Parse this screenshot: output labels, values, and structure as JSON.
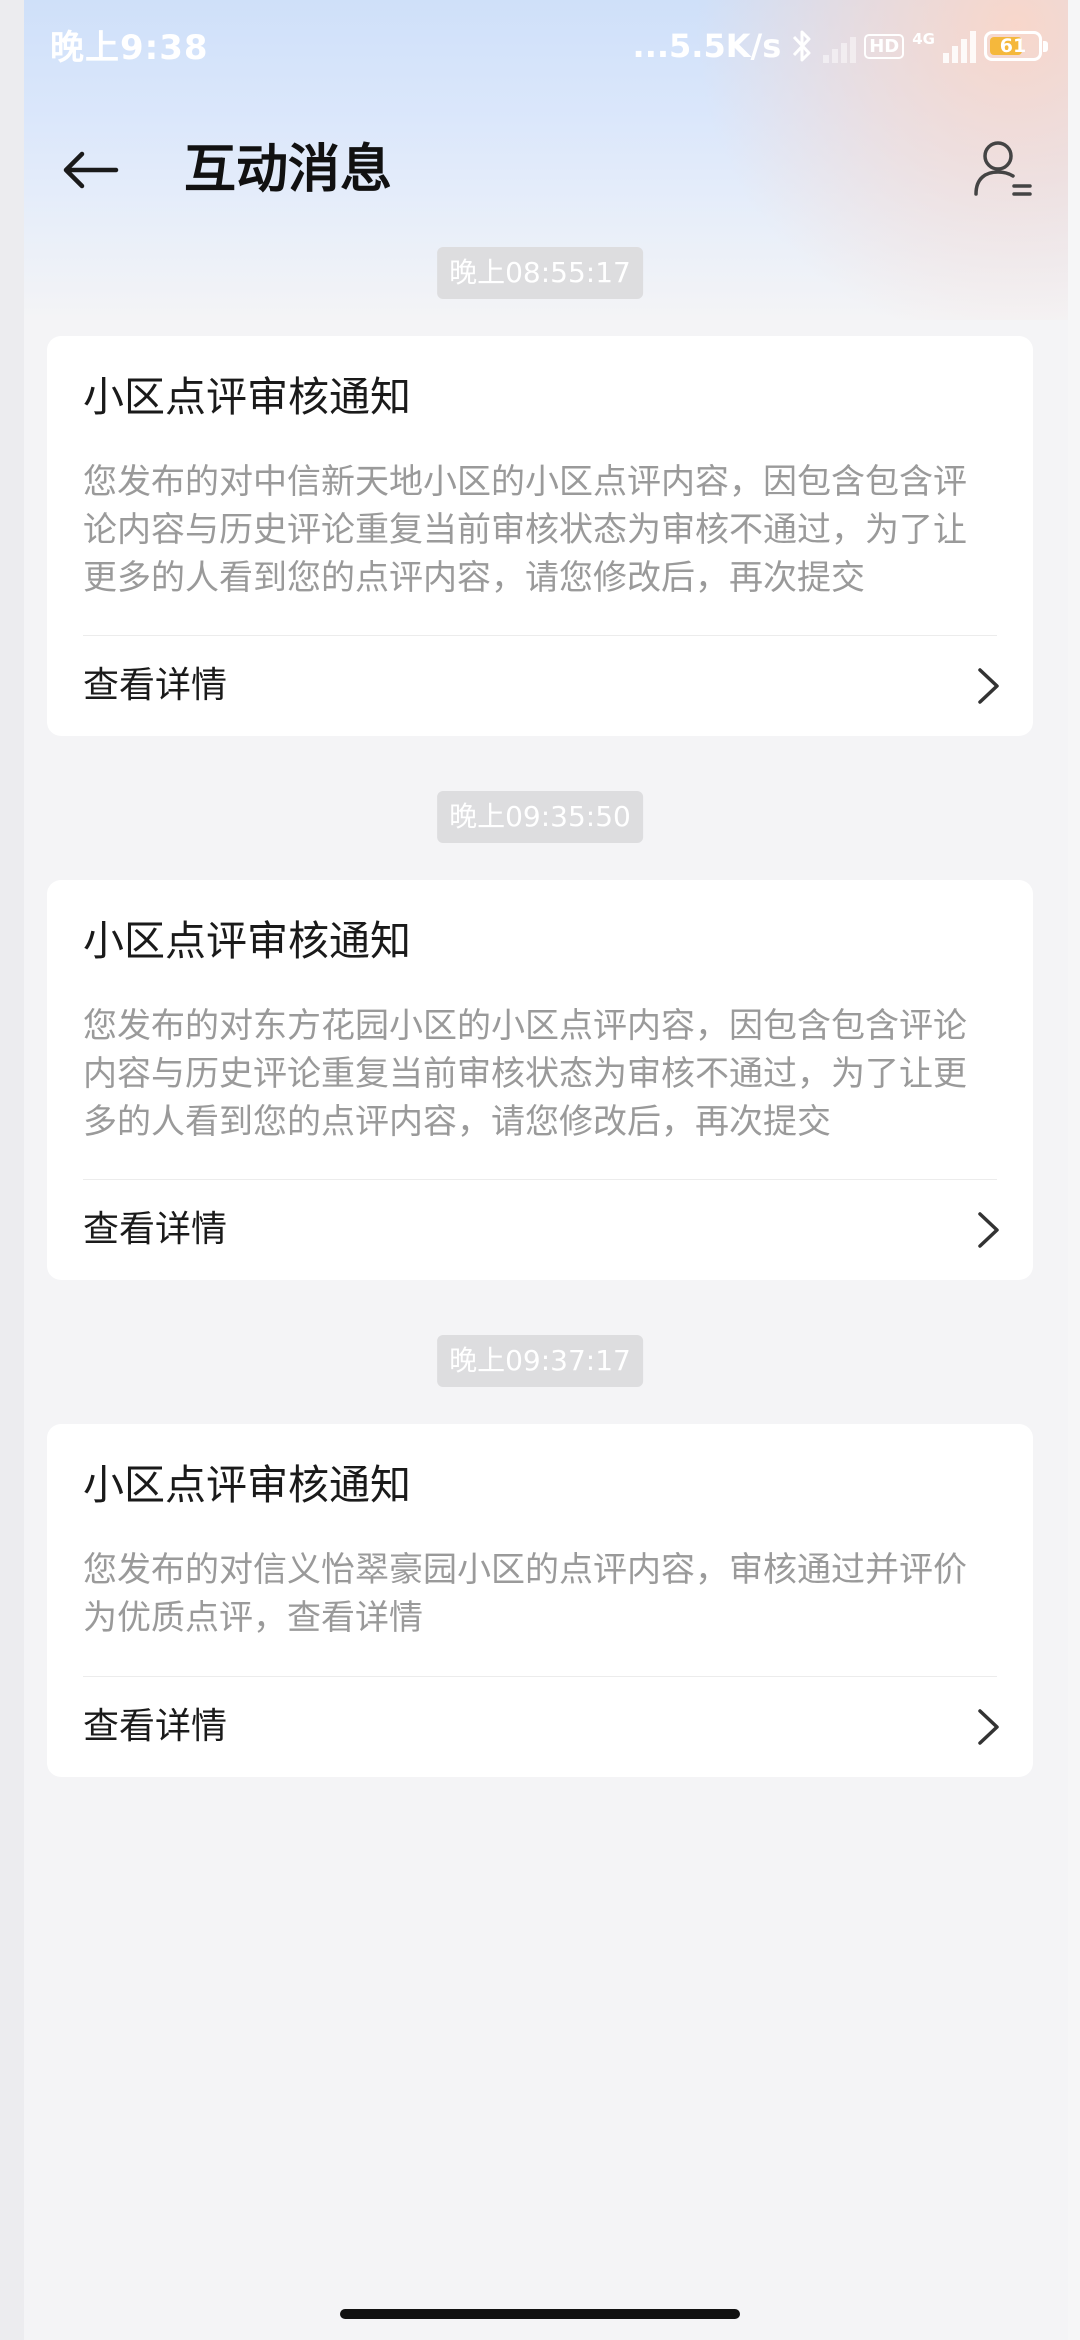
{
  "status_bar": {
    "time": "晚上9:38",
    "net_speed": "...5.5K/s",
    "hd": "HD",
    "network": "4G",
    "battery": "61"
  },
  "header": {
    "title": "互动消息"
  },
  "messages": [
    {
      "time": "晚上08:55:17",
      "title": "小区点评审核通知",
      "body": "您发布的对中信新天地小区的小区点评内容，因包含包含评论内容与历史评论重复当前审核状态为审核不通过，为了让更多的人看到您的点评内容，请您修改后，再次提交",
      "action": "查看详情"
    },
    {
      "time": "晚上09:35:50",
      "title": "小区点评审核通知",
      "body": "您发布的对东方花园小区的小区点评内容，因包含包含评论内容与历史评论重复当前审核状态为审核不通过，为了让更多的人看到您的点评内容，请您修改后，再次提交",
      "action": "查看详情"
    },
    {
      "time": "晚上09:37:17",
      "title": "小区点评审核通知",
      "body": "您发布的对信义怡翠豪园小区的点评内容，审核通过并评价为优质点评，查看详情",
      "action": "查看详情"
    }
  ]
}
